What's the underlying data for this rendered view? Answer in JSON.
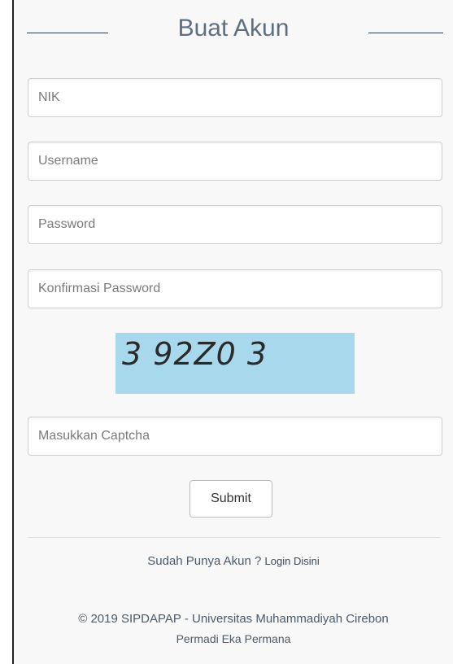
{
  "header": {
    "title": "Buat Akun"
  },
  "form": {
    "nik": {
      "placeholder": "NIK",
      "value": ""
    },
    "username": {
      "placeholder": "Username",
      "value": ""
    },
    "password": {
      "placeholder": "Password",
      "value": ""
    },
    "confirm_password": {
      "placeholder": "Konfirmasi Password",
      "value": ""
    },
    "captcha_code": "3 92Z0 3",
    "captcha_input": {
      "placeholder": "Masukkan Captcha",
      "value": ""
    },
    "submit_label": "Submit"
  },
  "login_prompt": {
    "text": "Sudah Punya Akun ? ",
    "link_label": "Login Disini"
  },
  "footer": {
    "copyright": "© 2019 SIPDAPAP - Universitas Muhammadiyah Cirebon",
    "author": "Permadi Eka Permana"
  },
  "colors": {
    "captcha_bg": "#a8d8ec",
    "title": "#5f6f82",
    "panel_bg": "#f8f8f8"
  }
}
